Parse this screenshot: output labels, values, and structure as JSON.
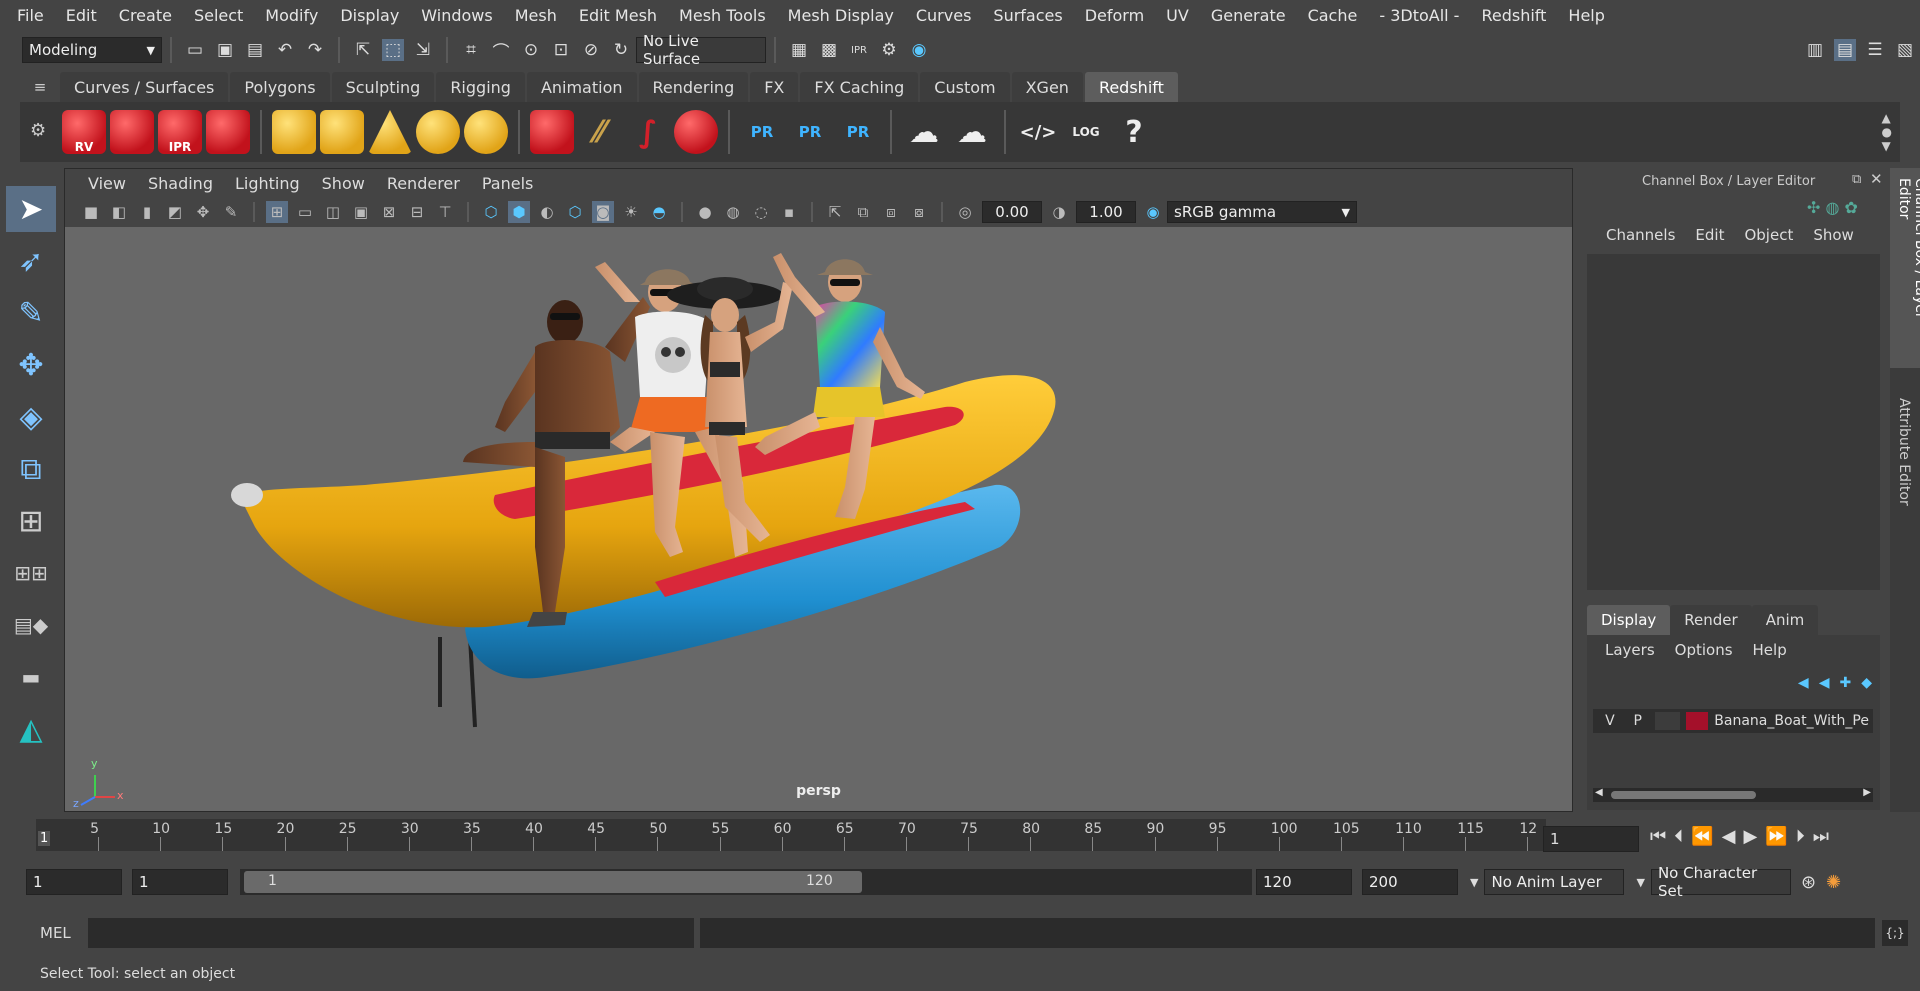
{
  "menu": [
    "File",
    "Edit",
    "Create",
    "Select",
    "Modify",
    "Display",
    "Windows",
    "Mesh",
    "Edit Mesh",
    "Mesh Tools",
    "Mesh Display",
    "Curves",
    "Surfaces",
    "Deform",
    "UV",
    "Generate",
    "Cache",
    "- 3DtoAll -",
    "Redshift",
    "Help"
  ],
  "status": {
    "mode": "Modeling",
    "live_surface": "No Live Surface"
  },
  "shelf_tabs": [
    "Curves / Surfaces",
    "Polygons",
    "Sculpting",
    "Rigging",
    "Animation",
    "Rendering",
    "FX",
    "FX Caching",
    "Custom",
    "XGen",
    "Redshift"
  ],
  "active_shelf_tab": "Redshift",
  "shelf_labels": {
    "rv": "RV",
    "ipr": "IPR",
    "pr1": "PR",
    "pr2": "PR",
    "pr3": "PR",
    "log": "LOG",
    "help": "?"
  },
  "viewport": {
    "menu": [
      "View",
      "Shading",
      "Lighting",
      "Show",
      "Renderer",
      "Panels"
    ],
    "exposure": "0.00",
    "gamma": "1.00",
    "color_space": "sRGB gamma",
    "camera_label": "persp",
    "axis": {
      "x": "x",
      "y": "y",
      "z": "z"
    }
  },
  "channel_box": {
    "title": "Channel Box / Layer Editor",
    "menu": [
      "Channels",
      "Edit",
      "Object",
      "Show"
    ]
  },
  "layer_editor": {
    "tabs": [
      "Display",
      "Render",
      "Anim"
    ],
    "active_tab": "Display",
    "menu": [
      "Layers",
      "Options",
      "Help"
    ],
    "layer": {
      "v": "V",
      "p": "P",
      "name": "Banana_Boat_With_Pe",
      "color": "#a4102a"
    }
  },
  "side_tabs": [
    "Channel Box / Layer Editor",
    "Attribute Editor"
  ],
  "timeline": {
    "ticks": [
      "5",
      "10",
      "15",
      "20",
      "25",
      "30",
      "35",
      "40",
      "45",
      "50",
      "55",
      "60",
      "65",
      "70",
      "75",
      "80",
      "85",
      "90",
      "95",
      "100",
      "105",
      "110",
      "115",
      "12"
    ],
    "start_marker": "1",
    "current_frame": "1"
  },
  "range": {
    "start": "1",
    "playback_start": "1",
    "slider_start": "1",
    "slider_end": "120",
    "playback_end": "120",
    "end": "200",
    "anim_layer": "No Anim Layer",
    "character_set": "No Character Set"
  },
  "command": {
    "label": "MEL"
  },
  "help_line": "Select Tool: select an object",
  "colors": {
    "accent": "#5aaeff",
    "redshift": "#d3202a",
    "boat_yellow": "#e6a50f",
    "boat_blue": "#1f8fd0",
    "boat_red": "#d9283a"
  }
}
